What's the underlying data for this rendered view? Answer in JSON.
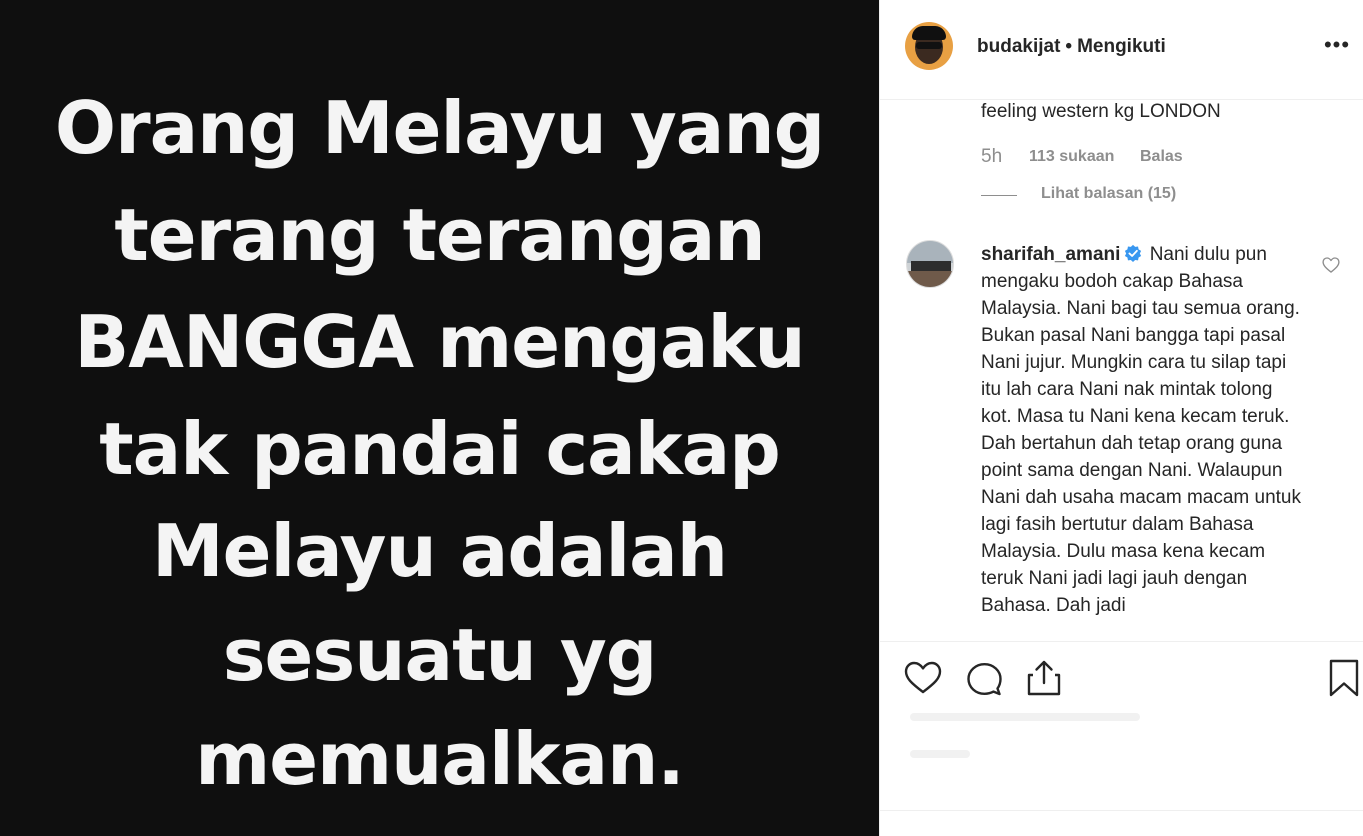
{
  "post_image": {
    "lines": [
      "Orang Melayu yang",
      "terang terangan",
      "BANGGA mengaku",
      "tak pandai cakap",
      "Melayu adalah",
      "sesuatu yg",
      "memualkan."
    ]
  },
  "header": {
    "username": "budakijat",
    "separator": "•",
    "follow_label": "Mengikuti",
    "more_label": "•••"
  },
  "previous_comment": {
    "text": "feeling western kg LONDON",
    "time": "5h",
    "likes": "113 sukaan",
    "reply_label": "Balas",
    "view_replies": "Lihat balasan (15)"
  },
  "comment": {
    "username": "sharifah_amani",
    "text": "Nani dulu pun mengaku bodoh cakap Bahasa Malaysia. Nani bagi tau semua orang. Bukan pasal Nani bangga tapi pasal Nani jujur. Mungkin cara tu silap tapi itu lah cara Nani nak mintak tolong kot. Masa tu Nani kena kecam teruk. Dah bertahun dah tetap orang guna point sama dengan Nani. Walaupun Nani dah usaha macam macam untuk lagi fasih bertutur dalam Bahasa Malaysia. Dulu masa kena kecam teruk Nani jadi lagi jauh dengan Bahasa. Dah jadi"
  },
  "icons": {
    "like": "heart-icon",
    "comment": "comment-bubble-icon",
    "share": "share-icon",
    "save": "bookmark-icon",
    "verified": "verified-badge-icon"
  },
  "colors": {
    "verified": "#3897f0",
    "muted": "#8e8e8e",
    "text": "#262626",
    "image_bg": "#0f0f0f"
  }
}
